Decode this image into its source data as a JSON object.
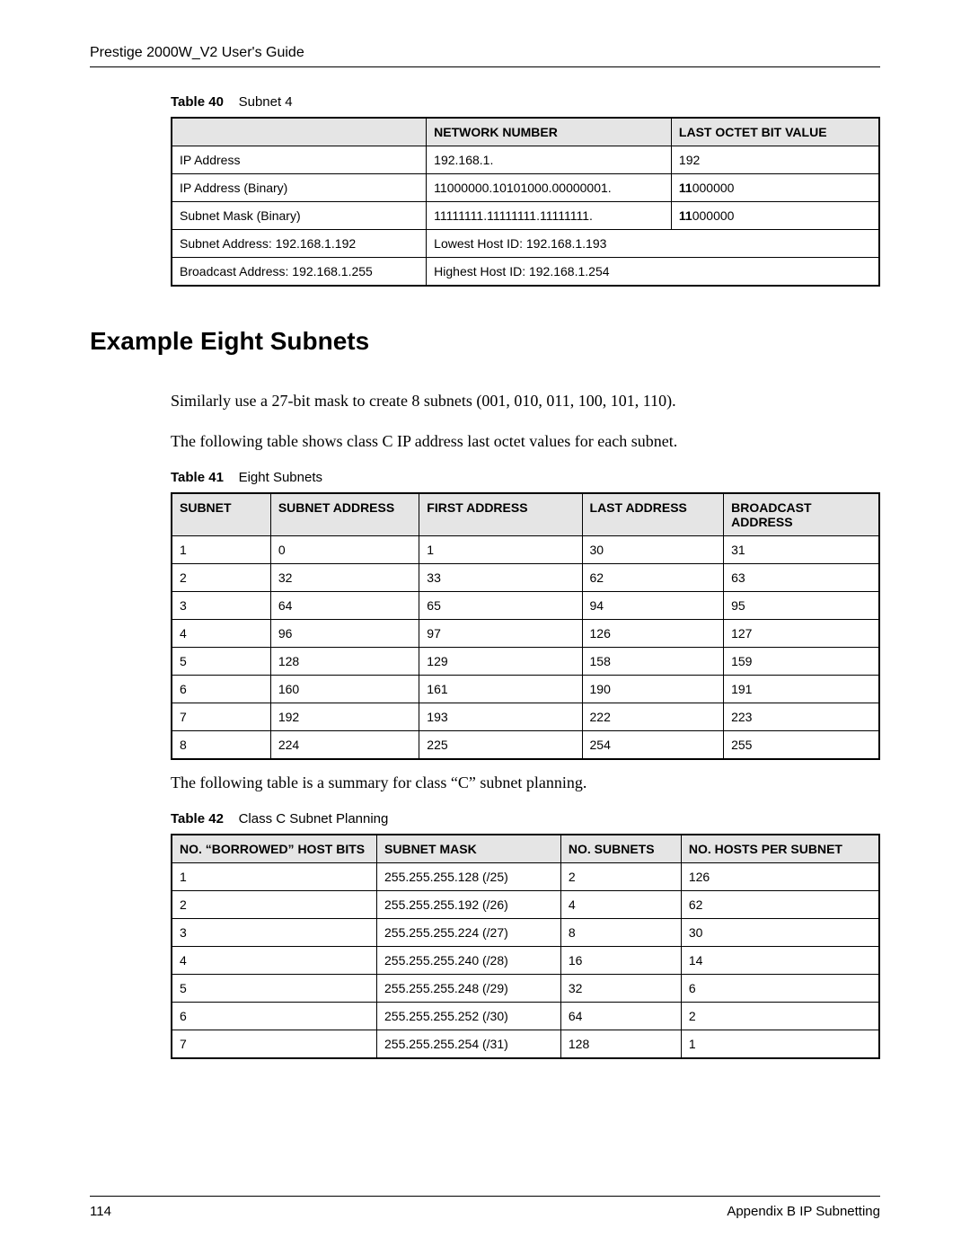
{
  "header": {
    "title": "Prestige 2000W_V2 User's Guide"
  },
  "table40": {
    "caption_label": "Table 40",
    "caption_text": "Subnet 4",
    "headers": {
      "c1_blank": "",
      "c2": "NETWORK NUMBER",
      "c3": "LAST OCTET BIT VALUE"
    },
    "rows": [
      {
        "c1": "IP Address",
        "c2": "192.168.1.",
        "c3": "192"
      },
      {
        "c1": "IP Address (Binary)",
        "c2": "11000000.10101000.00000001.",
        "c3_a": "11",
        "c3_b": "000000"
      },
      {
        "c1": "Subnet Mask (Binary)",
        "c2": "11111111.11111111.11111111.",
        "c3_a": "11",
        "c3_b": "000000"
      }
    ],
    "span_rows": [
      {
        "c1": "Subnet Address: 192.168.1.192",
        "c2": "Lowest Host ID: 192.168.1.193"
      },
      {
        "c1": "Broadcast Address: 192.168.1.255",
        "c2": "Highest Host ID: 192.168.1.254"
      }
    ]
  },
  "section_head": "Example Eight Subnets",
  "para1": "Similarly use a 27-bit mask to create 8 subnets (001, 010, 011, 100, 101, 110).",
  "para2": "The following table shows class C IP address last octet values for each subnet.",
  "table41": {
    "caption_label": "Table 41",
    "caption_text": "Eight Subnets",
    "headers": {
      "c1": "SUBNET",
      "c2": "SUBNET ADDRESS",
      "c3": "FIRST ADDRESS",
      "c4": "LAST ADDRESS",
      "c5": "BROADCAST ADDRESS"
    },
    "rows": [
      {
        "c1": "1",
        "c2": "0",
        "c3": "1",
        "c4": "30",
        "c5": "31"
      },
      {
        "c1": "2",
        "c2": "32",
        "c3": "33",
        "c4": "62",
        "c5": "63"
      },
      {
        "c1": "3",
        "c2": "64",
        "c3": "65",
        "c4": "94",
        "c5": "95"
      },
      {
        "c1": "4",
        "c2": "96",
        "c3": "97",
        "c4": "126",
        "c5": "127"
      },
      {
        "c1": "5",
        "c2": "128",
        "c3": "129",
        "c4": "158",
        "c5": "159"
      },
      {
        "c1": "6",
        "c2": "160",
        "c3": "161",
        "c4": "190",
        "c5": "191"
      },
      {
        "c1": "7",
        "c2": "192",
        "c3": "193",
        "c4": "222",
        "c5": "223"
      },
      {
        "c1": "8",
        "c2": "224",
        "c3": "225",
        "c4": "254",
        "c5": "255"
      }
    ]
  },
  "para3": "The following table is a summary for class “C” subnet planning.",
  "table42": {
    "caption_label": "Table 42",
    "caption_text": "Class C Subnet Planning",
    "headers": {
      "c1": "NO. “BORROWED” HOST BITS",
      "c2": "SUBNET MASK",
      "c3": "NO. SUBNETS",
      "c4": "NO. HOSTS PER SUBNET"
    },
    "rows": [
      {
        "c1": "1",
        "c2": "255.255.255.128 (/25)",
        "c3": "2",
        "c4": "126"
      },
      {
        "c1": "2",
        "c2": "255.255.255.192 (/26)",
        "c3": "4",
        "c4": "62"
      },
      {
        "c1": "3",
        "c2": "255.255.255.224 (/27)",
        "c3": "8",
        "c4": "30"
      },
      {
        "c1": "4",
        "c2": "255.255.255.240 (/28)",
        "c3": "16",
        "c4": "14"
      },
      {
        "c1": "5",
        "c2": "255.255.255.248 (/29)",
        "c3": "32",
        "c4": "6"
      },
      {
        "c1": "6",
        "c2": "255.255.255.252 (/30)",
        "c3": "64",
        "c4": "2"
      },
      {
        "c1": "7",
        "c2": "255.255.255.254 (/31)",
        "c3": "128",
        "c4": "1"
      }
    ]
  },
  "footer": {
    "page_no": "114",
    "section": "Appendix B IP Subnetting"
  }
}
